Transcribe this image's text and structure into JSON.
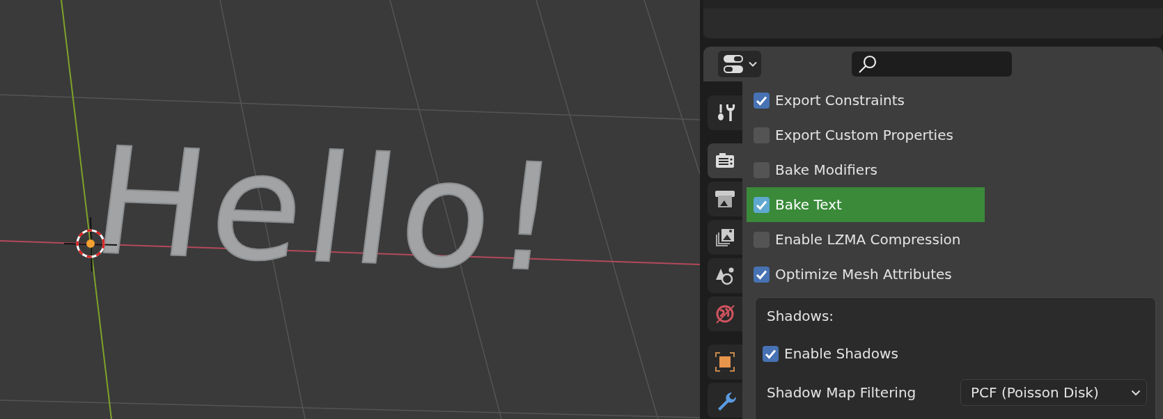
{
  "viewport": {
    "object_text": "Hello!"
  },
  "properties": {
    "tabs": [
      {
        "kind": "tool",
        "selected": false
      },
      {
        "kind": "render",
        "selected": true
      },
      {
        "kind": "output",
        "selected": false
      },
      {
        "kind": "view_layer",
        "selected": false
      },
      {
        "kind": "scene",
        "selected": false
      },
      {
        "kind": "world",
        "selected": false
      },
      {
        "kind": "object",
        "selected": false
      },
      {
        "kind": "modifier",
        "selected": false
      }
    ],
    "options": [
      {
        "label": "Export Constraints",
        "checked": true,
        "selected": false
      },
      {
        "label": "Export Custom Properties",
        "checked": false,
        "selected": false
      },
      {
        "label": "Bake Modifiers",
        "checked": false,
        "selected": false
      },
      {
        "label": "Bake Text",
        "checked": true,
        "selected": true
      },
      {
        "label": "Enable LZMA Compression",
        "checked": false,
        "selected": false
      },
      {
        "label": "Optimize Mesh Attributes",
        "checked": true,
        "selected": false
      }
    ],
    "shadows": {
      "heading": "Shadows:",
      "enable": {
        "label": "Enable Shadows",
        "checked": true
      },
      "filtering": {
        "label": "Shadow Map Filtering",
        "value": "PCF (Poisson Disk)"
      }
    }
  }
}
